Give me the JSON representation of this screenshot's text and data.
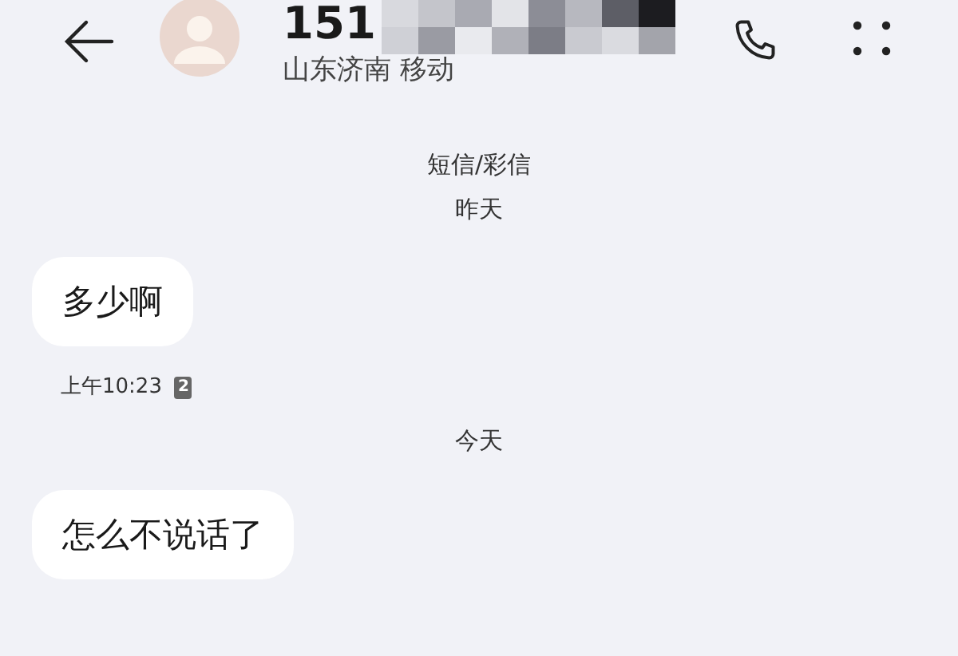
{
  "header": {
    "number": "151",
    "location": "山东济南 移动"
  },
  "thread": [
    {
      "kind": "label",
      "text": "短信/彩信"
    },
    {
      "kind": "label",
      "text": "昨天"
    },
    {
      "kind": "message",
      "text": "多少啊",
      "time": "上午10:23",
      "sim": "2"
    },
    {
      "kind": "label",
      "text": "今天"
    },
    {
      "kind": "message",
      "text": "怎么不说话了"
    }
  ]
}
